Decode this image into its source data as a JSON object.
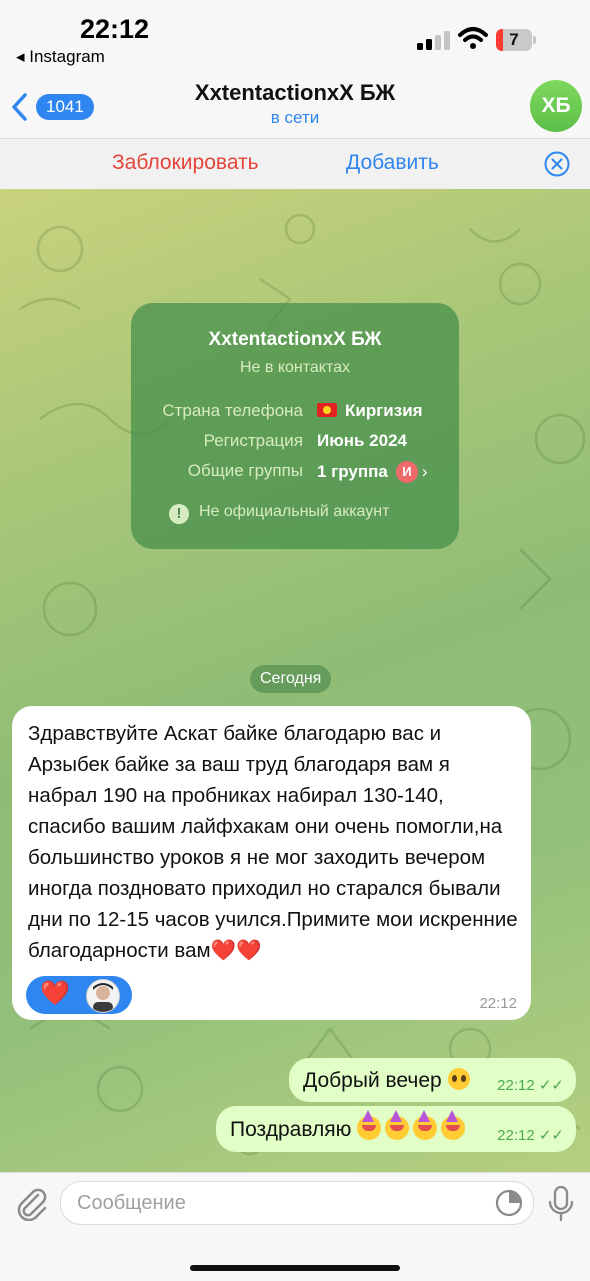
{
  "status_bar": {
    "time": "22:12",
    "back_app": "◂ Instagram",
    "battery_level": "7",
    "battery_color": "#ff3b30"
  },
  "header": {
    "back_badge": "1041",
    "title": "XxtentactionxX БЖ",
    "status": "в сети",
    "avatar_initials": "ХБ"
  },
  "actions": {
    "block_label": "Заблокировать",
    "add_label": "Добавить",
    "close_icon": "close-circle-icon"
  },
  "info_card": {
    "name": "XxtentactionxX БЖ",
    "subtitle": "Не в контактах",
    "rows": [
      {
        "label": "Страна телефона",
        "value": "Киргизия"
      },
      {
        "label": "Регистрация",
        "value": "Июнь 2024"
      },
      {
        "label": "Общие группы",
        "value": "1 группа",
        "badge": "И"
      }
    ],
    "note": "Не официальный аккаунт"
  },
  "date_separator": "Сегодня",
  "messages": {
    "incoming": {
      "text": "Здравствуйте Аскат байке благодарю вас и Арзыбек байке за ваш труд благодаря вам я набрал 190 на пробниках набирал 130-140, спасибо вашим лайфхакам они очень помогли,на большинство уроков я не мог заходить вечером иногда поздновато приходил но старался бывали дни по 12-15 часов учился.Примите мои искренние благодарности вам",
      "emoji_suffix": "❤️❤️",
      "time": "22:12",
      "reaction": "❤️"
    },
    "outgoing": [
      {
        "text": "Добрый вечер",
        "time": "22:12"
      },
      {
        "text": "Поздравляю",
        "time": "22:12"
      }
    ]
  },
  "input": {
    "placeholder": "Сообщение"
  },
  "colors": {
    "accent": "#2f86f0",
    "danger": "#e5443a",
    "outgoing_bubble": "#e1fec6",
    "info_card": "#428e4a"
  }
}
